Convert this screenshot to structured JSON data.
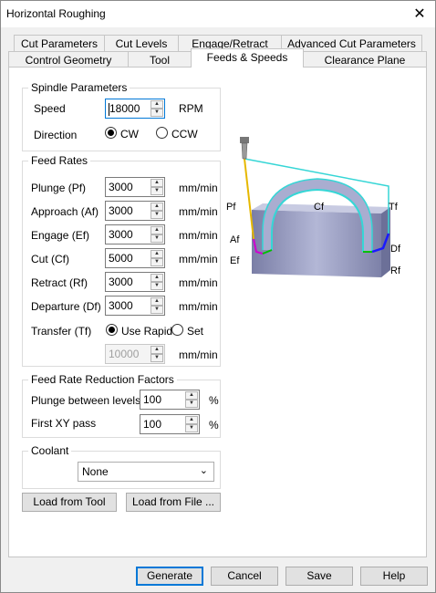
{
  "window": {
    "title": "Horizontal Roughing",
    "close_symbol": "✕"
  },
  "tabs": {
    "row1": [
      "Cut Parameters",
      "Cut Levels",
      "Engage/Retract",
      "Advanced Cut Parameters"
    ],
    "row2": [
      "Control Geometry",
      "Tool",
      "Feeds & Speeds",
      "Clearance Plane"
    ],
    "active": "Feeds & Speeds"
  },
  "spindle": {
    "title": "Spindle Parameters",
    "speed_label": "Speed",
    "speed_value": "18000",
    "speed_unit": "RPM",
    "direction_label": "Direction",
    "cw_label": "CW",
    "ccw_label": "CCW",
    "direction_selected": "CW"
  },
  "feed_rates": {
    "title": "Feed Rates",
    "unit": "mm/min",
    "plunge_label": "Plunge (Pf)",
    "plunge_value": "3000",
    "approach_label": "Approach (Af)",
    "approach_value": "3000",
    "engage_label": "Engage (Ef)",
    "engage_value": "3000",
    "cut_label": "Cut (Cf)",
    "cut_value": "5000",
    "retract_label": "Retract (Rf)",
    "retract_value": "3000",
    "departure_label": "Departure  (Df)",
    "departure_value": "3000",
    "transfer_label": "Transfer (Tf)",
    "use_rapid_label": "Use Rapid",
    "set_label": "Set",
    "transfer_selected": "Use Rapid",
    "transfer_value": "10000"
  },
  "reduction": {
    "title": "Feed Rate Reduction Factors",
    "plunge_levels_label": "Plunge between levels",
    "plunge_levels_value": "100",
    "first_xy_label": "First XY pass",
    "first_xy_value": "100",
    "percent": "%"
  },
  "coolant": {
    "title": "Coolant",
    "value": "None"
  },
  "load_buttons": {
    "from_tool": "Load from Tool",
    "from_file": "Load from File ..."
  },
  "footer": {
    "generate": "Generate",
    "cancel": "Cancel",
    "save": "Save",
    "help": "Help"
  },
  "illustration_labels": {
    "pf": "Pf",
    "af": "Af",
    "ef": "Ef",
    "cf": "Cf",
    "tf": "Tf",
    "df": "Df",
    "rf": "Rf"
  },
  "colors": {
    "accent": "#0078d7",
    "part_body": "#9fa3c4",
    "tool_path_transfer": "#36d6d6",
    "tool_path_plunge": "#e6b800",
    "tool_path_approach": "#d000d0",
    "tool_path_engage": "#00c000",
    "tool_path_departure": "#1a1aff"
  }
}
